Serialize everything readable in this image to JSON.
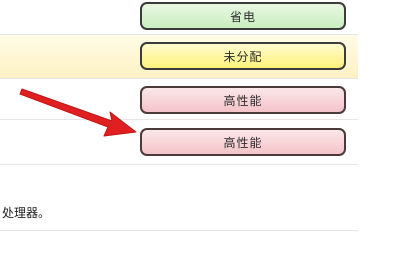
{
  "plan_rows": [
    {
      "label": "省电",
      "state": "green"
    },
    {
      "label": "未分配",
      "state": "yellow"
    },
    {
      "label": "高性能",
      "state": "red"
    },
    {
      "label": "高性能",
      "state": "red"
    }
  ],
  "description_text": "处理器。",
  "colors": {
    "green": "#c9eebf",
    "yellow": "#fff27a",
    "red": "#f4c3c9",
    "highlight_row": "#fdf2c4",
    "arrow": "#e02020"
  }
}
